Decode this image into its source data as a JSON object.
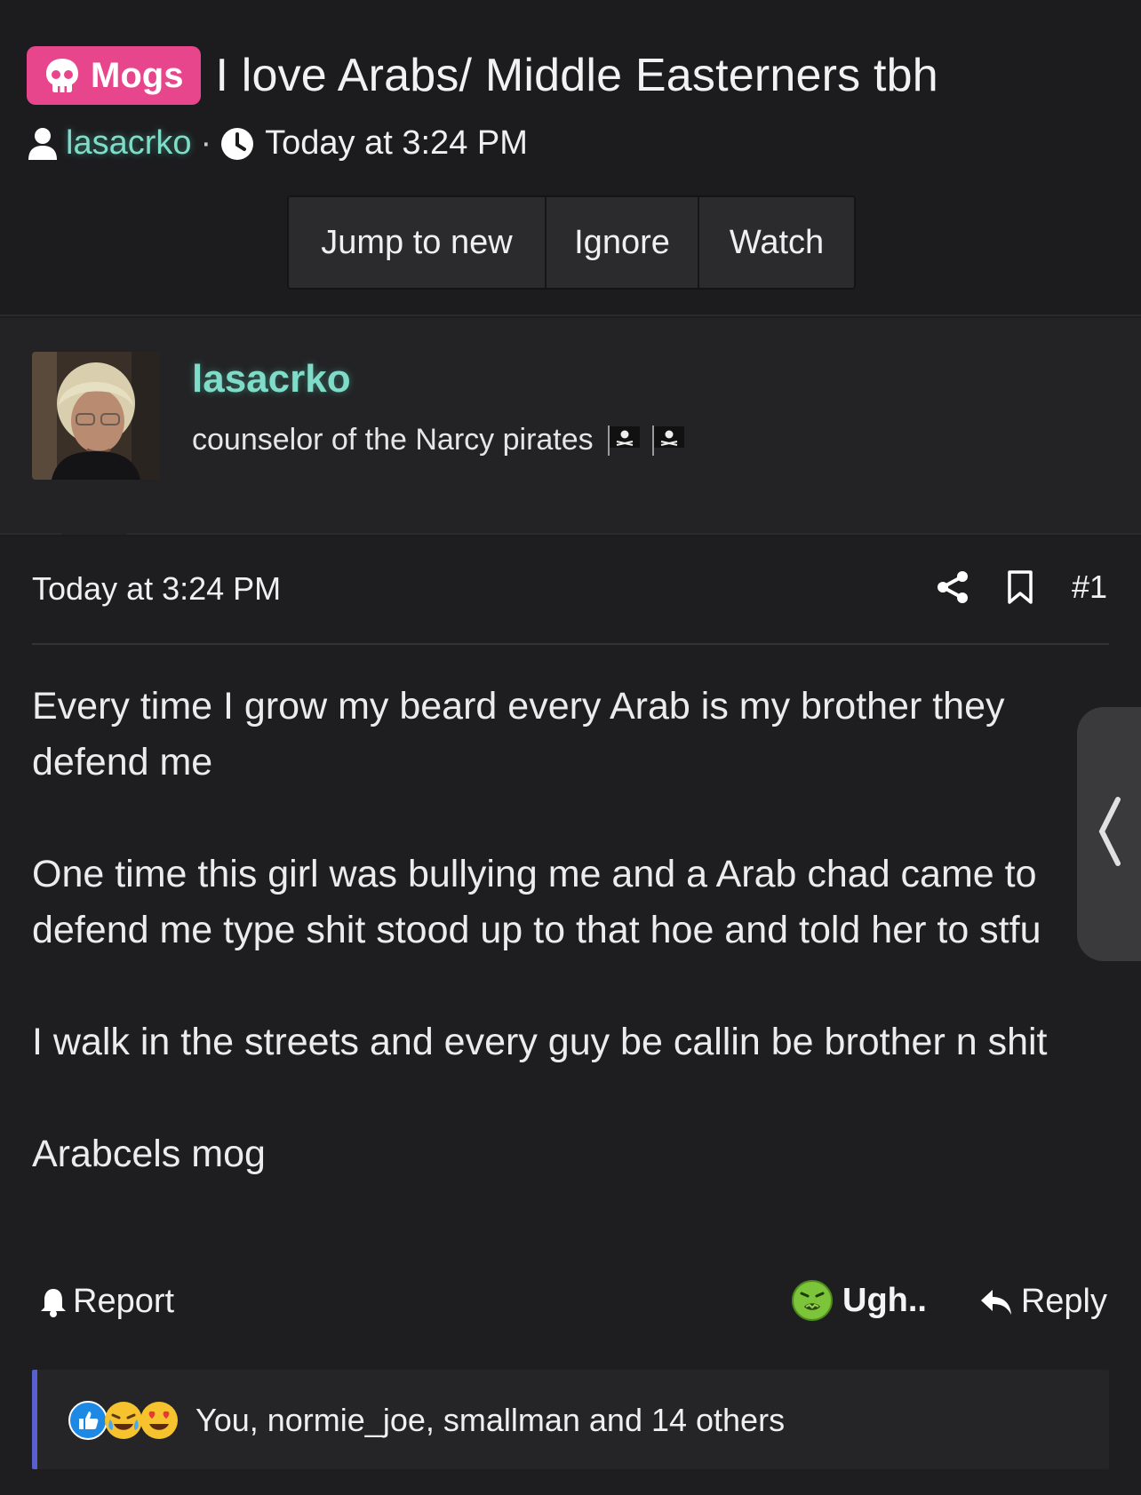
{
  "thread": {
    "prefix": "Mogs",
    "title": "I love Arabs/ Middle Easterners tbh",
    "author": "lasacrko",
    "separator": "·",
    "time": "Today at 3:24 PM",
    "buttons": {
      "jump": "Jump to new",
      "ignore": "Ignore",
      "watch": "Watch"
    }
  },
  "user": {
    "name": "lasacrko",
    "title": "counselor of the Narcy pirates"
  },
  "post": {
    "time": "Today at 3:24 PM",
    "number": "#1",
    "body": "Every time I grow my beard every Arab is my brother they defend me\n\nOne time this girl was bullying me and a Arab chad came to defend me type shit stood up to that hoe and told her to stfu\n\nI walk in the streets and every guy be callin be brother n shit\n\nArabcels mog",
    "report_label": "Report",
    "reaction_label": "Ugh..",
    "reply_label": "Reply"
  },
  "reactions": {
    "summary": "You, normie_joe, smallman and 14 others",
    "icons": [
      "like-icon",
      "crying-laughing-icon",
      "heart-eyes-icon"
    ]
  },
  "colors": {
    "background": "#1c1c1e",
    "prefix_badge": "#e8468c",
    "username": "#7fdcc8",
    "reaction_bar_accent": "#5a5fd0"
  }
}
